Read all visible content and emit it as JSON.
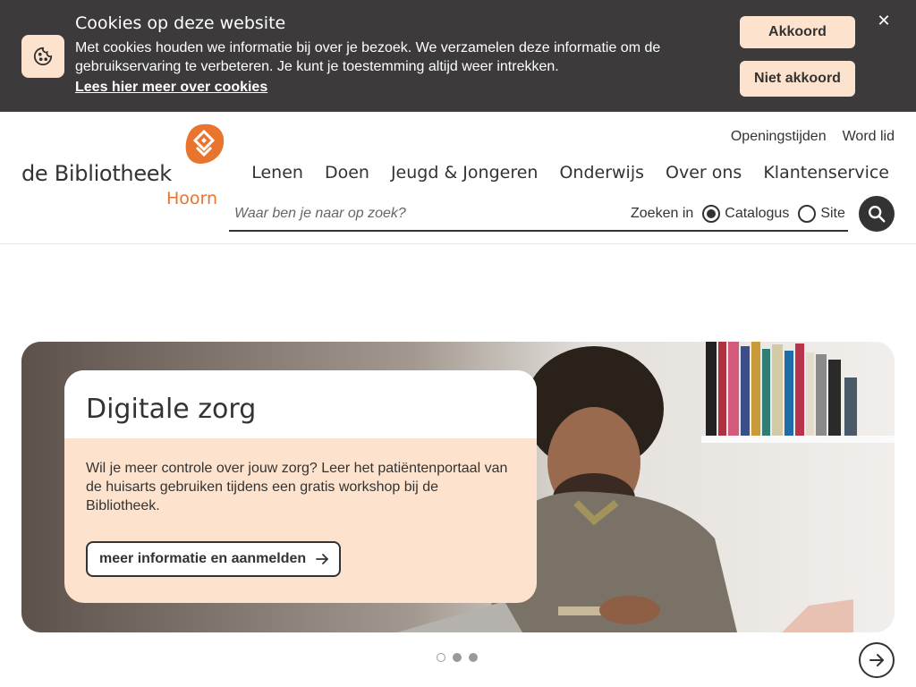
{
  "cookie": {
    "title": "Cookies op deze website",
    "text": "Met cookies houden we informatie bij over je bezoek. We verzamelen deze informatie om de gebruikservaring te verbeteren. Je kunt je toestemming altijd weer intrekken.",
    "link": "Lees hier meer over cookies",
    "accept": "Akkoord",
    "decline": "Niet akkoord",
    "close": "✕"
  },
  "header": {
    "logo": {
      "main": "de Bibliotheek",
      "sub": "Hoorn"
    },
    "top_links": [
      "Openingstijden",
      "Word lid"
    ],
    "nav": [
      "Lenen",
      "Doen",
      "Jeugd & Jongeren",
      "Onderwijs",
      "Over ons",
      "Klantenservice"
    ]
  },
  "search": {
    "placeholder": "Waar ben je naar op zoek?",
    "scope_label": "Zoeken in",
    "options": [
      {
        "label": "Catalogus",
        "checked": true
      },
      {
        "label": "Site",
        "checked": false
      }
    ]
  },
  "hero": {
    "title": "Digitale zorg",
    "text": "Wil je meer controle over jouw zorg? Leer het patiëntenportaal van de huisarts gebruiken tijdens een gratis workshop bij de Bibliotheek.",
    "button": "meer informatie en aanmelden"
  },
  "carousel": {
    "slide_count": 3,
    "active_slide": 1
  },
  "colors": {
    "accent": "#e8742d",
    "peach": "#fde3cd",
    "dark": "#3c3a3b"
  }
}
